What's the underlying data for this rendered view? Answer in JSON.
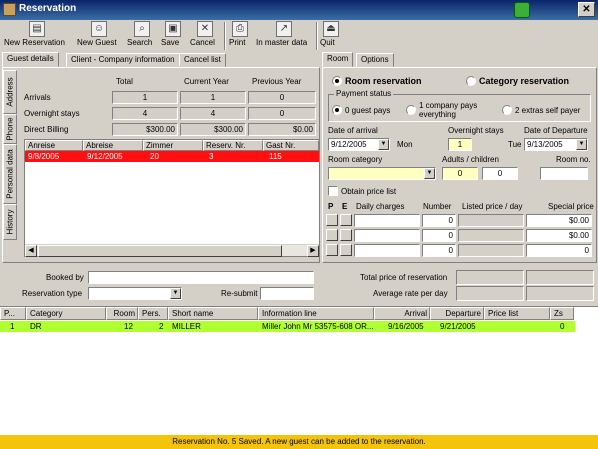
{
  "window": {
    "title": "Reservation"
  },
  "toolbar": {
    "buttons": [
      {
        "label": "New Reservation",
        "icon": "new-reservation-icon",
        "glyph": "▤"
      },
      {
        "label": "New Guest",
        "icon": "new-guest-icon",
        "glyph": "☺"
      },
      {
        "label": "Search",
        "icon": "search-icon",
        "glyph": "⌕"
      },
      {
        "label": "Save",
        "icon": "save-icon",
        "glyph": "▣"
      },
      {
        "label": "Cancel",
        "icon": "cancel-icon",
        "glyph": "✕"
      },
      {
        "label": "Print",
        "icon": "print-icon",
        "glyph": "⎙"
      },
      {
        "label": "In master data",
        "icon": "master-data-icon",
        "glyph": "↗"
      },
      {
        "label": "Quit",
        "icon": "quit-icon",
        "glyph": "⏏"
      }
    ]
  },
  "left_tabs": [
    "Guest details",
    "Client - Company information",
    "Cancel list"
  ],
  "right_tabs": [
    "Room",
    "Options"
  ],
  "vertical_tabs": [
    "Address",
    "Phone",
    "Personal data",
    "History"
  ],
  "stats": {
    "headers": [
      "Total",
      "Current Year",
      "Previous Year"
    ],
    "rows": [
      {
        "label": "Arrivals",
        "values": [
          "1",
          "1",
          "0"
        ]
      },
      {
        "label": "Overnight stays",
        "values": [
          "4",
          "4",
          "0"
        ]
      },
      {
        "label": "Direct Billing",
        "values": [
          "$300.00",
          "$300.00",
          "$0.00"
        ]
      }
    ]
  },
  "stay_grid": {
    "headers": [
      "Anreise",
      "Abreise",
      "Zimmer",
      "Reserv. Nr.",
      "Gast Nr."
    ],
    "row": [
      "9/8/2005",
      "9/12/2005",
      "20",
      "3",
      "115"
    ]
  },
  "room_panel": {
    "room_reservation": "Room reservation",
    "category_reservation": "Category reservation",
    "payment_status_title": "Payment status",
    "payment_options": [
      "0 guest pays",
      "1 company pays everything",
      "2 extras self payer"
    ],
    "date_of_arrival_label": "Date of arrival",
    "date_of_arrival": "9/12/2005",
    "arrival_day": "Mon",
    "overnight_stays_label": "Overnight stays",
    "overnight_stays": "1",
    "departure_day": "Tue",
    "date_of_departure_label": "Date of Departure",
    "date_of_departure": "9/13/2005",
    "room_category_label": "Room category",
    "adults_children_label": "Adults / children",
    "adults": "0",
    "children": "0",
    "room_no_label": "Room no.",
    "obtain_price_list": "Obtain price list",
    "p_label": "P",
    "e_label": "E",
    "daily_charges_label": "Daily charges",
    "number_label": "Number",
    "listed_price_label": "Listed price / day",
    "special_price_label": "Special price",
    "charge_rows": [
      {
        "number": "0",
        "special": "$0.00"
      },
      {
        "number": "0",
        "special": "$0.00"
      },
      {
        "number": "0",
        "special": "0"
      }
    ]
  },
  "booking": {
    "booked_by_label": "Booked by",
    "reservation_type_label": "Reservation type",
    "resubmit_label": "Re-submit",
    "total_price_label": "Total price of reservation",
    "average_rate_label": "Average rate per day"
  },
  "reservation_list": {
    "headers": [
      "P...",
      "Category",
      "Room",
      "Pers.",
      "Short name",
      "Information line",
      "Arrival",
      "Departure",
      "Price list",
      "Zs"
    ],
    "row": [
      "1",
      "DR",
      "12",
      "2",
      "MILLER",
      "Miller John Mr 53575-608 OR...",
      "9/16/2005",
      "9/21/2005",
      "",
      "0"
    ]
  },
  "status": "Reservation No. 5 Saved. A new guest can be added to the reservation."
}
